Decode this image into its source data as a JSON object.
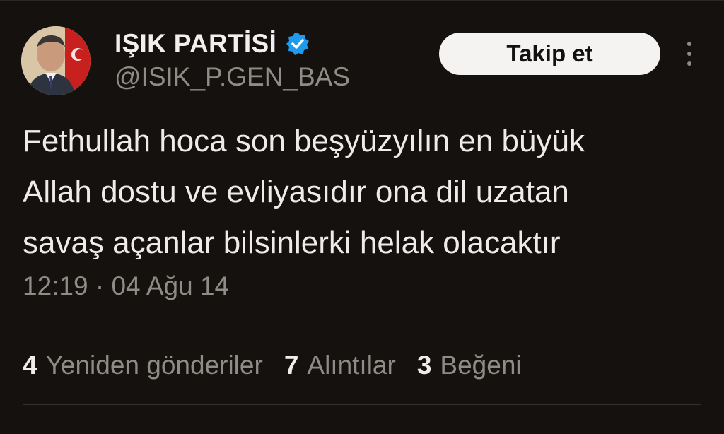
{
  "profile": {
    "display_name": "IŞIK PARTİSİ",
    "handle": "@ISIK_P.GEN_BAS",
    "follow_label": "Takip et"
  },
  "tweet": {
    "lines": [
      "Fethullah hoca son beşyüzyılın en büyük",
      "Allah dostu ve evliyasıdır ona dil uzatan",
      "savaş açanlar bilsinlerki helak olacaktır"
    ],
    "timestamp": "12:19 · 04 Ağu 14"
  },
  "stats": [
    {
      "count": "4",
      "label": "Yeniden gönderiler"
    },
    {
      "count": "7",
      "label": "Alıntılar"
    },
    {
      "count": "3",
      "label": "Beğeni"
    }
  ],
  "colors": {
    "background": "#15110f",
    "verified_badge": "#1d9bf0",
    "muted_text": "#8f8b86"
  },
  "icons": [
    "verified-badge-icon",
    "more-options-icon"
  ]
}
